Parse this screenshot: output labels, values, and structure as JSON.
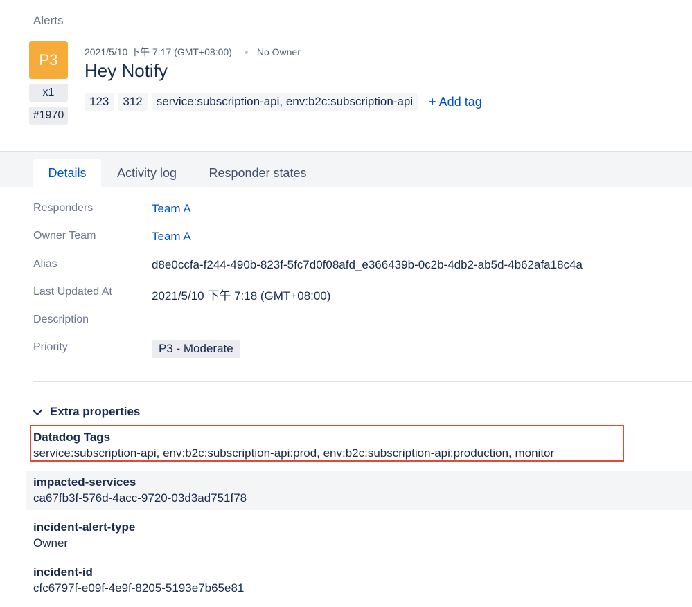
{
  "header": {
    "breadcrumb": "Alerts",
    "priority": "P3",
    "count": "x1",
    "number": "#1970",
    "created_at": "2021/5/10 下午 7:17 (GMT+08:00)",
    "owner": "No Owner",
    "title": "Hey Notify",
    "tags": [
      "123",
      "312",
      "service:subscription-api, env:b2c:subscription-api"
    ],
    "add_tag_label": "+ Add tag"
  },
  "tabs": [
    {
      "label": "Details",
      "active": true
    },
    {
      "label": "Activity log",
      "active": false
    },
    {
      "label": "Responder states",
      "active": false
    }
  ],
  "details": {
    "responders_label": "Responders",
    "responders_value": "Team A",
    "owner_team_label": "Owner Team",
    "owner_team_value": "Team A",
    "alias_label": "Alias",
    "alias_value": "d8e0ccfa-f244-490b-823f-5fc7d0f08afd_e366439b-0c2b-4db2-ab5d-4b62afa18c4a",
    "last_updated_label": "Last Updated At",
    "last_updated_value": "2021/5/10 下午 7:18 (GMT+08:00)",
    "description_label": "Description",
    "priority_label": "Priority",
    "priority_value": "P3 - Moderate"
  },
  "extra": {
    "header": "Extra properties",
    "properties": [
      {
        "name": "Datadog Tags",
        "value": "service:subscription-api, env:b2c:subscription-api:prod, env:b2c:subscription-api:production, monitor"
      },
      {
        "name": "impacted-services",
        "value": "ca67fb3f-576d-4acc-9720-03d3ad751f78"
      },
      {
        "name": "incident-alert-type",
        "value": "Owner"
      },
      {
        "name": "incident-id",
        "value": "cfc6797f-e09f-4e9f-8205-5193e7b65e81"
      }
    ]
  },
  "colors": {
    "priority_p3": "#f5ac3b",
    "link": "#0052cc",
    "highlight": "#e34935"
  }
}
